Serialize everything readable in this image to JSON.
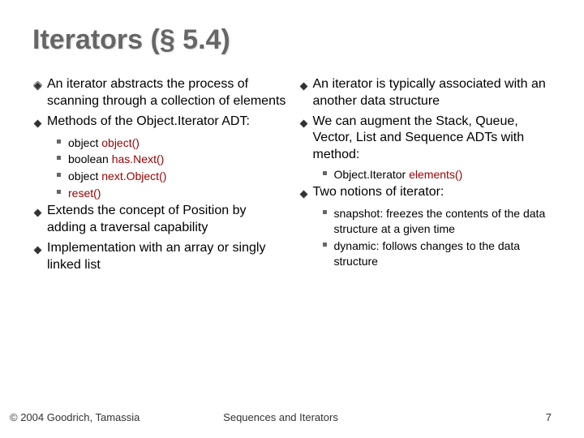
{
  "title": "Iterators (§ 5.4)",
  "accent": "#990000",
  "left": {
    "p1": "An iterator abstracts the process of scanning through a collection of elements",
    "p2_a": "Methods of the Object.Iterator ADT:",
    "m1_a": "object ",
    "m1_b": "object()",
    "m2_a": "boolean ",
    "m2_b": "has.Next()",
    "m3_a": "object ",
    "m3_b": "next.Object()",
    "m4": "reset()",
    "p3": "Extends the concept of Position by adding a traversal capability",
    "p4": "Implementation with an array or singly linked list"
  },
  "right": {
    "p1": "An iterator is typically associated with an another data structure",
    "p2": "We can augment the Stack, Queue, Vector, List and Sequence ADTs with method:",
    "m1_a": "Object.Iterator ",
    "m1_b": "elements()",
    "p3": "Two notions of iterator:",
    "s1": "snapshot: freezes the contents of the data structure at a given time",
    "s2": "dynamic: follows changes to the data structure"
  },
  "footer": {
    "left": "© 2004 Goodrich, Tamassia",
    "center": "Sequences and Iterators",
    "right": "7"
  }
}
